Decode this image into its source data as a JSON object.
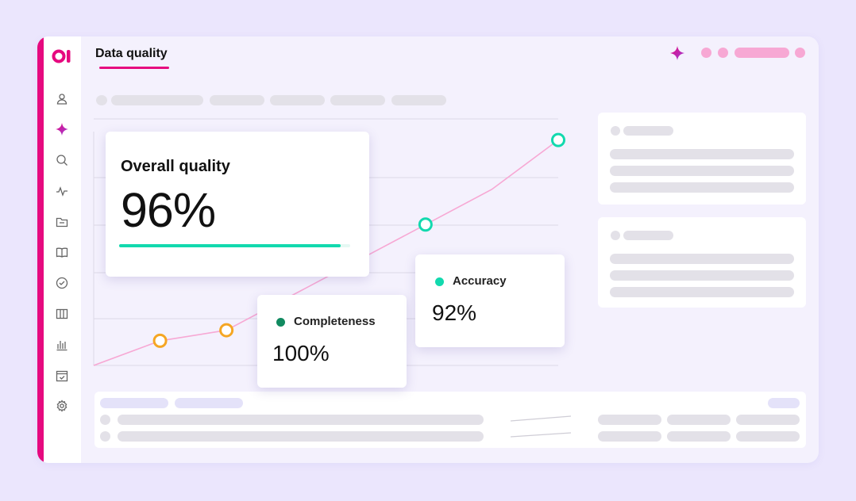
{
  "header": {
    "title": "Data quality"
  },
  "sidebar": {
    "items": [
      {
        "icon": "user-icon"
      },
      {
        "icon": "sparkle-icon",
        "active": true
      },
      {
        "icon": "search-icon"
      },
      {
        "icon": "activity-icon"
      },
      {
        "icon": "folder-icon"
      },
      {
        "icon": "book-icon"
      },
      {
        "icon": "check-circle-icon"
      },
      {
        "icon": "columns-icon"
      },
      {
        "icon": "bar-chart-icon"
      },
      {
        "icon": "calendar-check-icon"
      },
      {
        "icon": "gear-icon"
      }
    ]
  },
  "overall": {
    "title": "Overall quality",
    "value": "96%",
    "progress": 0.96
  },
  "metrics": [
    {
      "label": "Completeness",
      "value": "100%",
      "dot_color": "#118a60"
    },
    {
      "label": "Accuracy",
      "value": "92%",
      "dot_color": "#12d9ae"
    }
  ],
  "colors": {
    "brand": "#e6097f",
    "line": "#f7a8d4",
    "teal": "#12d9ae",
    "orange": "#f5a623"
  },
  "chart_data": {
    "type": "line",
    "title": "",
    "xlabel": "",
    "ylabel": "",
    "series": [
      {
        "x": [
          0,
          1,
          2,
          3,
          4,
          5,
          6,
          7
        ],
        "values": [
          0,
          7,
          10,
          20,
          30,
          40,
          50,
          64
        ],
        "markers": [
          {
            "index": 1,
            "color": "orange"
          },
          {
            "index": 2,
            "color": "orange"
          },
          {
            "index": 5,
            "color": "teal"
          },
          {
            "index": 7,
            "color": "teal"
          }
        ]
      }
    ],
    "xlim": [
      0,
      7
    ],
    "ylim": [
      0,
      70
    ],
    "grid": true
  }
}
